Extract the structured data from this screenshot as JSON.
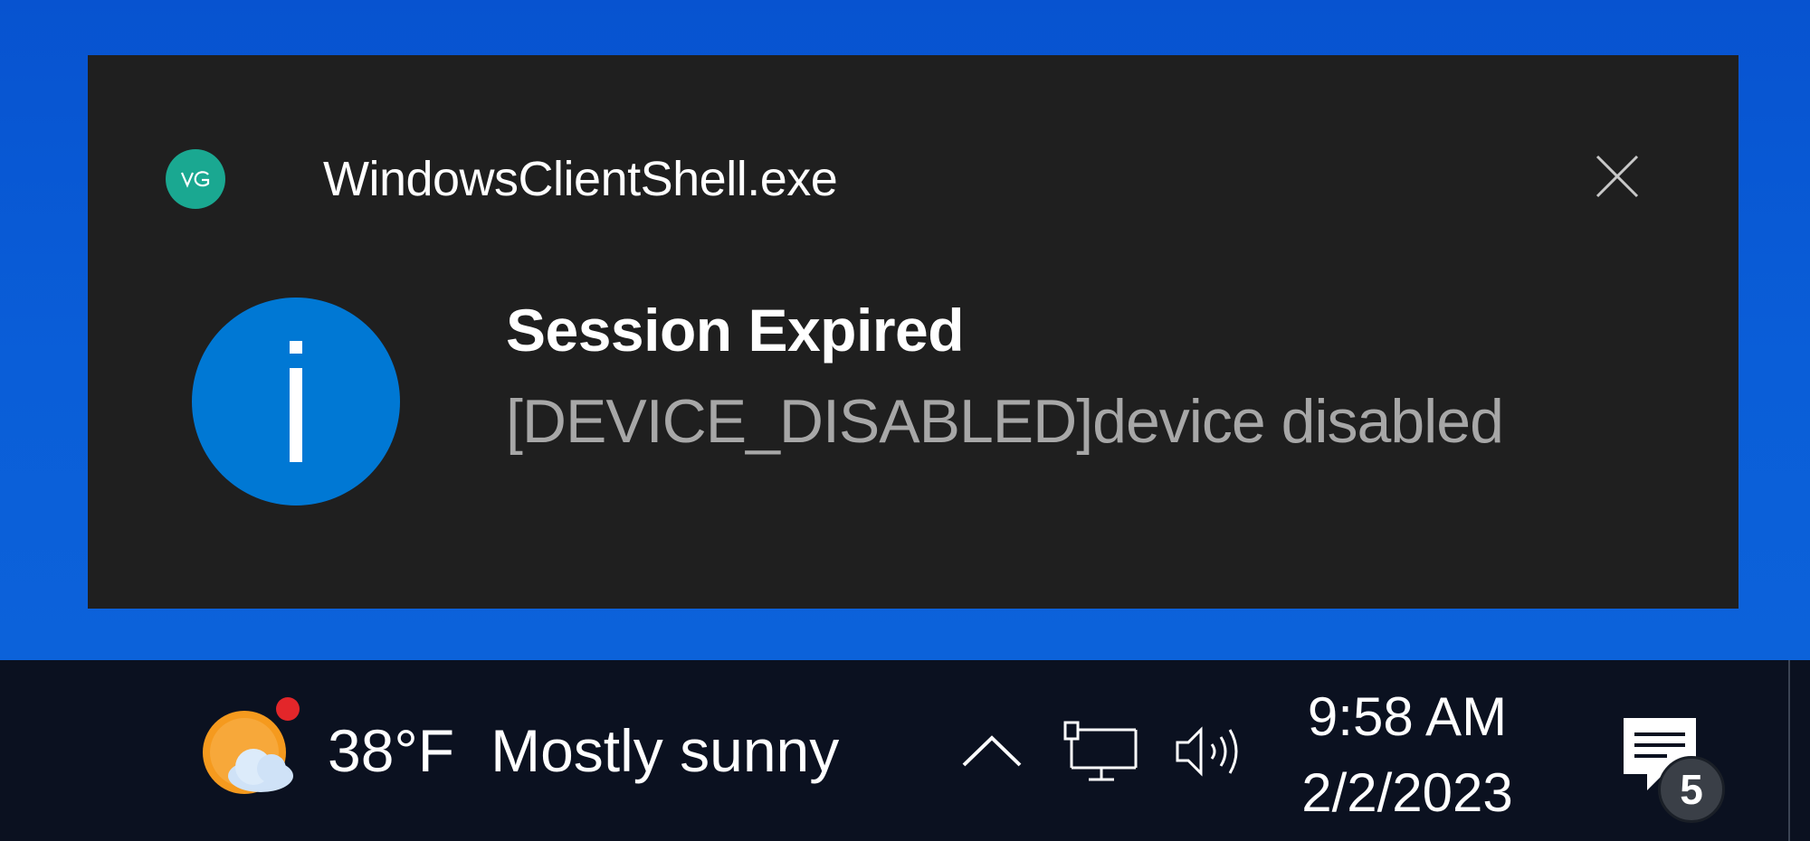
{
  "toast": {
    "app_name": "WindowsClientShell.exe",
    "app_icon_text": "VG",
    "title": "Session Expired",
    "message": "[DEVICE_DISABLED]device disabled",
    "close_icon": "close-icon",
    "info_icon": "info-icon",
    "accent_color": "#0078d4",
    "app_icon_color": "#1aa891"
  },
  "taskbar": {
    "weather": {
      "temperature": "38°F",
      "condition": "Mostly sunny",
      "icon": "weather-sun-cloud-icon"
    },
    "tray": {
      "chevron_icon": "chevron-up-icon",
      "network_icon": "network-icon",
      "volume_icon": "volume-icon"
    },
    "clock": {
      "time": "9:58 AM",
      "date": "2/2/2023"
    },
    "notifications": {
      "icon": "notification-center-icon",
      "count": "5"
    }
  }
}
